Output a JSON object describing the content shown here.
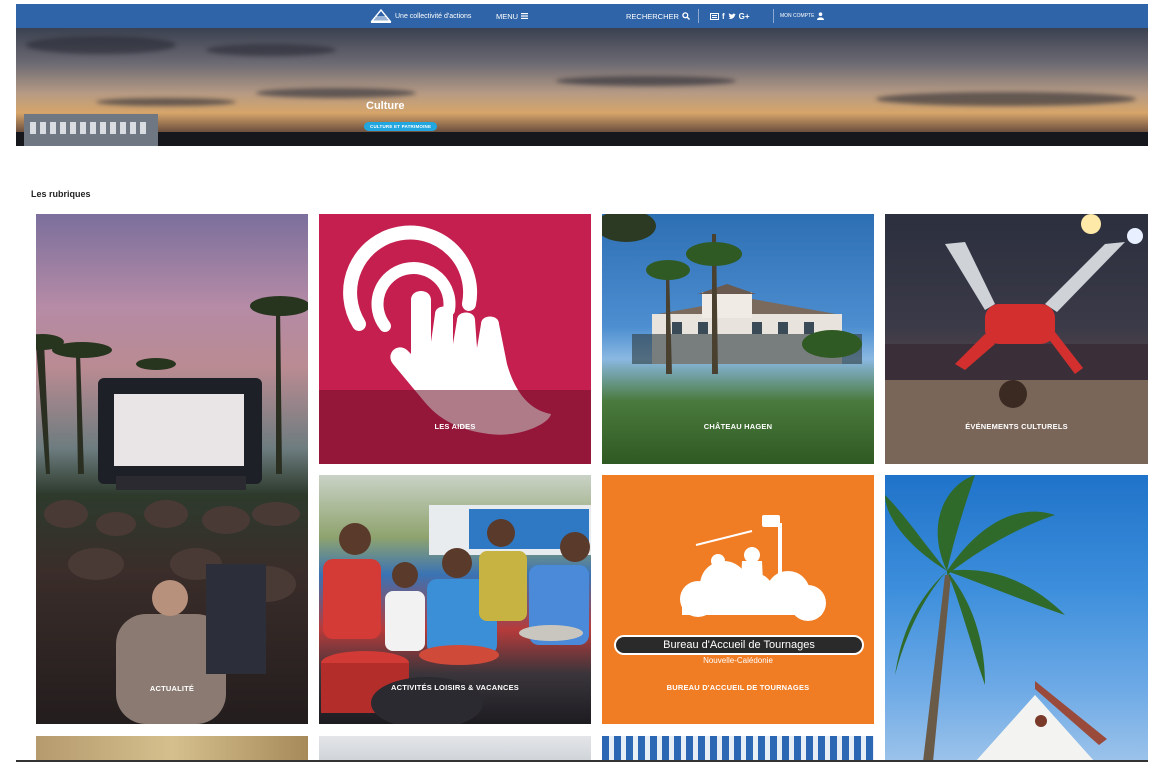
{
  "nav": {
    "tagline": "Une collectivité d'actions",
    "menu_label": "MENU",
    "search_label": "RECHERCHER",
    "social": [
      "f",
      "G+"
    ],
    "account_label": "MON COMPTE"
  },
  "hero": {
    "title": "Culture",
    "tag": "CULTURE ET PATRIMOINE"
  },
  "section": {
    "title": "Les rubriques"
  },
  "tiles": [
    {
      "label": "ACTUALITÉ"
    },
    {
      "label": "LES AIDES"
    },
    {
      "label": "CHÂTEAU HAGEN"
    },
    {
      "label": "ÉVÉNEMENTS CULTURELS"
    },
    {
      "label": "ACTIVITÉS LOISIRS & VACANCES"
    },
    {
      "label": "BUREAU D'ACCUEIL DE TOURNAGES"
    }
  ],
  "bureau_logo": {
    "line1": "Bureau d'Accueil de Tournages",
    "line2": "Nouvelle-Calédonie"
  },
  "colors": {
    "nav_bg": "#2f64a8",
    "aides_bg": "#c41f4e",
    "bureau_bg": "#f07c23",
    "tag_bg": "#21a6df"
  }
}
